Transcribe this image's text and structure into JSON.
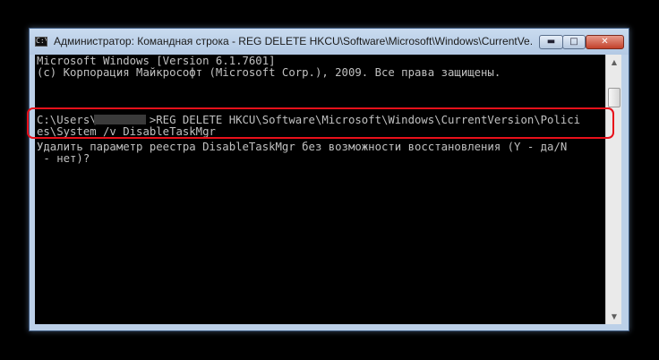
{
  "window": {
    "title": "Администратор: Командная строка - REG  DELETE HKCU\\Software\\Microsoft\\Windows\\CurrentVe...",
    "icon": "console-icon",
    "controls": {
      "minimize": "minimize-icon",
      "maximize": "maximize-icon",
      "close": "close-icon"
    }
  },
  "console": {
    "lines": [
      "Microsoft Windows [Version 6.1.7601]",
      "(c) Корпорация Майкрософт (Microsoft Corp.), 2009. Все права защищены.",
      "",
      "C:\\Users\\        >REG DELETE HKCU\\Software\\Microsoft\\Windows\\CurrentVersion\\Polici",
      "es\\System /v DisableTaskMgr",
      "Удалить параметр реестра DisableTaskMgr без возможности восстановления (Y - да/N",
      " - нет)?"
    ]
  },
  "colors": {
    "console_background": "#000000",
    "console_text": "#c0c0c0",
    "highlight_border": "#e8101a",
    "titlebar": "#bcd0e8"
  }
}
